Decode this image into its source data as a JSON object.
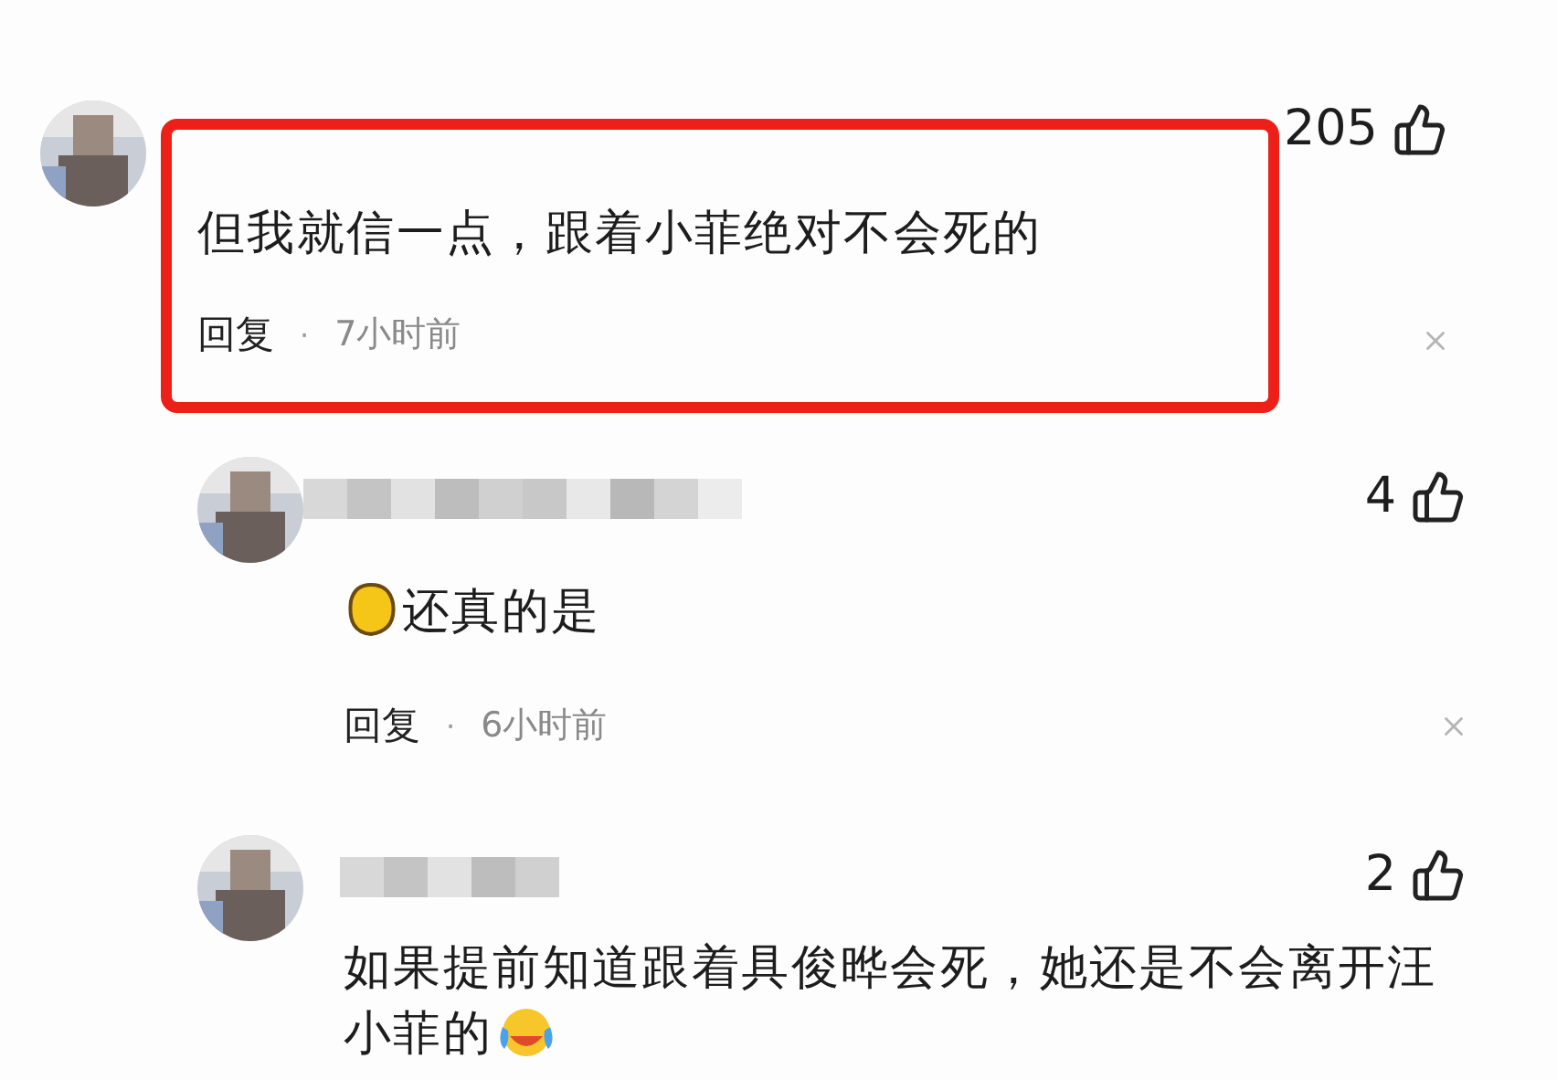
{
  "comment": {
    "likes": "205",
    "highlighted": true,
    "text": "但我就信一点，跟着小菲绝对不会死的",
    "reply": "回复",
    "separator": "·",
    "time": "7小时前",
    "children": [
      {
        "likes": "4",
        "leading_emoji": true,
        "trailing_emoji": false,
        "text": "还真的是",
        "reply": "回复",
        "separator": "·",
        "time": "6小时前"
      },
      {
        "likes": "2",
        "leading_emoji": false,
        "trailing_emoji": true,
        "text": "如果提前知道跟着具俊晔会死，她还是不会离开汪小菲的"
      }
    ]
  }
}
